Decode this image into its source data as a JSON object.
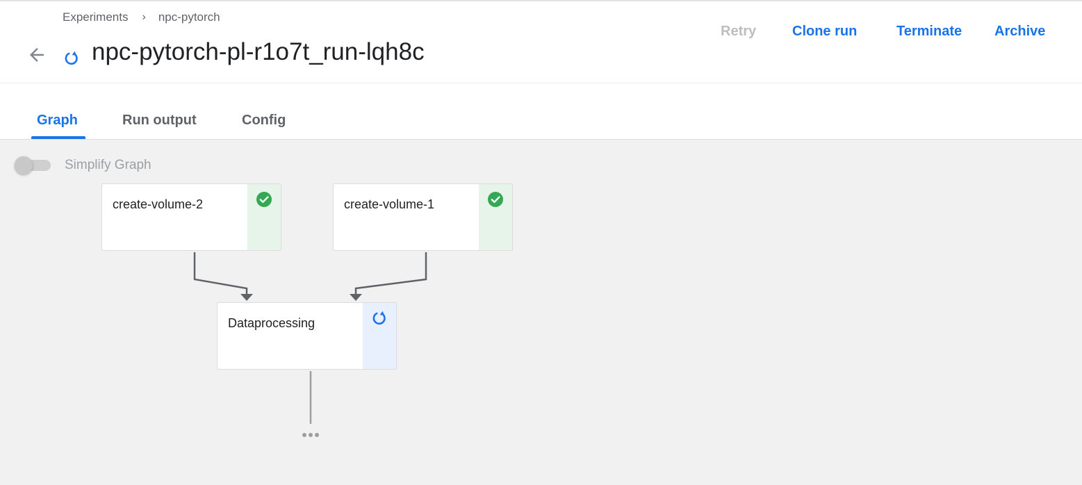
{
  "breadcrumb": {
    "items": [
      "Experiments",
      "npc-pytorch"
    ],
    "separator": "›"
  },
  "header": {
    "title": "npc-pytorch-pl-r1o7t_run-lqh8c",
    "status": "running"
  },
  "actions": {
    "retry": "Retry",
    "clone_run": "Clone run",
    "terminate": "Terminate",
    "archive": "Archive"
  },
  "tabs": [
    {
      "label": "Graph",
      "active": true
    },
    {
      "label": "Run output",
      "active": false
    },
    {
      "label": "Config",
      "active": false
    }
  ],
  "graph": {
    "simplify_label": "Simplify Graph",
    "simplify_enabled": false,
    "nodes": [
      {
        "label": "create-volume-2",
        "status": "succeeded"
      },
      {
        "label": "create-volume-1",
        "status": "succeeded"
      },
      {
        "label": "Dataprocessing",
        "status": "running"
      }
    ]
  },
  "colors": {
    "accent": "#1a73e8",
    "success": "#34a853",
    "success_bg": "#e6f4ea",
    "running_bg": "#e8f0fe",
    "canvas": "#f1f1f1"
  }
}
